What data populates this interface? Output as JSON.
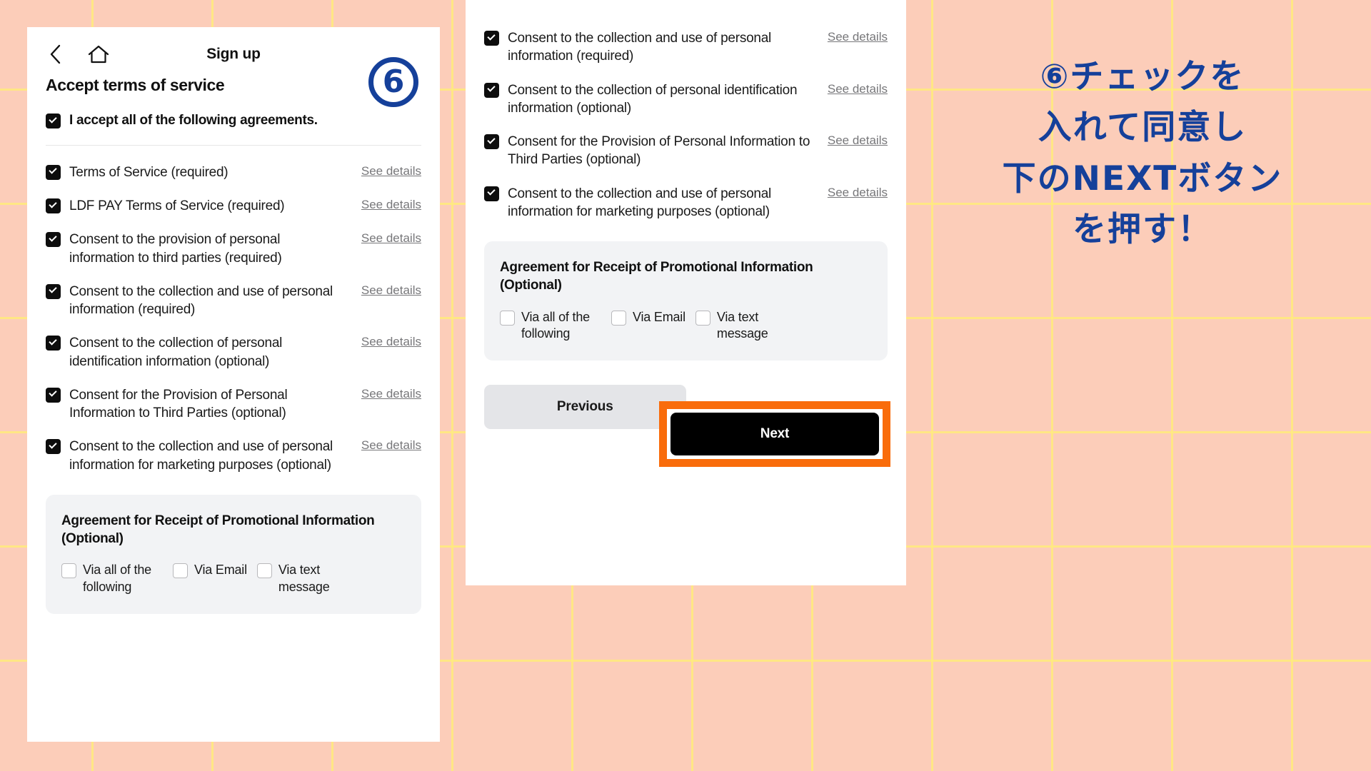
{
  "background": {
    "fill_color": "#fccdb9",
    "grid_line_color": "#ffe982"
  },
  "accent_colors": {
    "annotation_blue": "#15409a",
    "highlight_orange": "#f96c0b",
    "checkbox_checked": "#0d0d0d",
    "promo_box_gray": "#f2f3f5",
    "previous_button_gray": "#e4e5e8"
  },
  "screen": {
    "header": {
      "back_icon": "chevron-left-icon",
      "home_icon": "home-icon",
      "title": "Sign up",
      "step_badge": "⑥"
    },
    "page_title": "Accept terms of service",
    "accept_all": {
      "label": "I accept all of the following agreements.",
      "checked": true
    },
    "see_details_label": "See details",
    "agreements": [
      {
        "text": "Terms of Service (required)",
        "checked": true
      },
      {
        "text": "LDF PAY Terms of Service (required)",
        "checked": true
      },
      {
        "text": "Consent to the provision of personal information to third parties (required)",
        "checked": true
      },
      {
        "text": "Consent to the collection and use of personal information (required)",
        "checked": true
      },
      {
        "text": "Consent to the collection of personal identification information (optional)",
        "checked": true
      },
      {
        "text": "Consent for the Provision of Personal Information to Third Parties (optional)",
        "checked": true
      },
      {
        "text": "Consent to the collection and use of personal information for marketing purposes (optional)",
        "checked": true
      }
    ],
    "promo": {
      "title": "Agreement for Receipt of Promotional Information (Optional)",
      "options": [
        {
          "label": "Via all of the following",
          "checked": false
        },
        {
          "label": "Via Email",
          "checked": false
        },
        {
          "label": "Via text message",
          "checked": false
        }
      ]
    },
    "footer": {
      "previous_label": "Previous",
      "next_label": "Next"
    }
  },
  "right_panel": {
    "visible_agreements": [
      {
        "text": "Consent to the collection and use of personal information (required)",
        "checked": true
      },
      {
        "text": "Consent to the collection of personal identification information (optional)",
        "checked": true
      },
      {
        "text": "Consent for the Provision of Personal Information to Third Parties (optional)",
        "checked": true
      },
      {
        "text": "Consent to the collection and use of personal information for marketing purposes (optional)",
        "checked": true
      }
    ]
  },
  "annotation": {
    "lines": [
      "⑥チェックを",
      "入れて同意し",
      "下のNEXTボタン",
      "を押す！"
    ]
  }
}
